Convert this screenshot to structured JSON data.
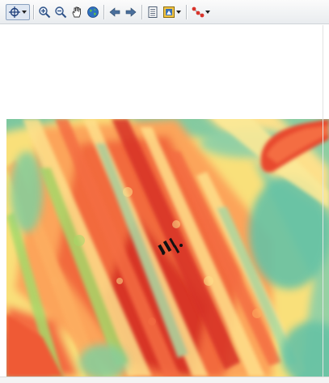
{
  "toolbar": {
    "tools": [
      {
        "icon": "select-crosshair-icon",
        "has_dropdown": true
      },
      {
        "icon": "zoom-in-icon"
      },
      {
        "icon": "zoom-out-icon"
      },
      {
        "icon": "pan-hand-icon"
      },
      {
        "icon": "full-extent-globe-icon"
      },
      {
        "icon": "previous-extent-arrow-icon"
      },
      {
        "icon": "next-extent-arrow-icon"
      },
      {
        "icon": "attribute-table-icon"
      },
      {
        "icon": "identify-layer-icon",
        "has_dropdown": true
      },
      {
        "icon": "network-points-icon",
        "has_dropdown": true
      }
    ]
  },
  "colors": {
    "low": "#66c2a5",
    "mid_low": "#a6d96a",
    "mid": "#fee08b",
    "mid_high": "#fdae61",
    "high": "#f46d43",
    "max": "#d73027"
  }
}
